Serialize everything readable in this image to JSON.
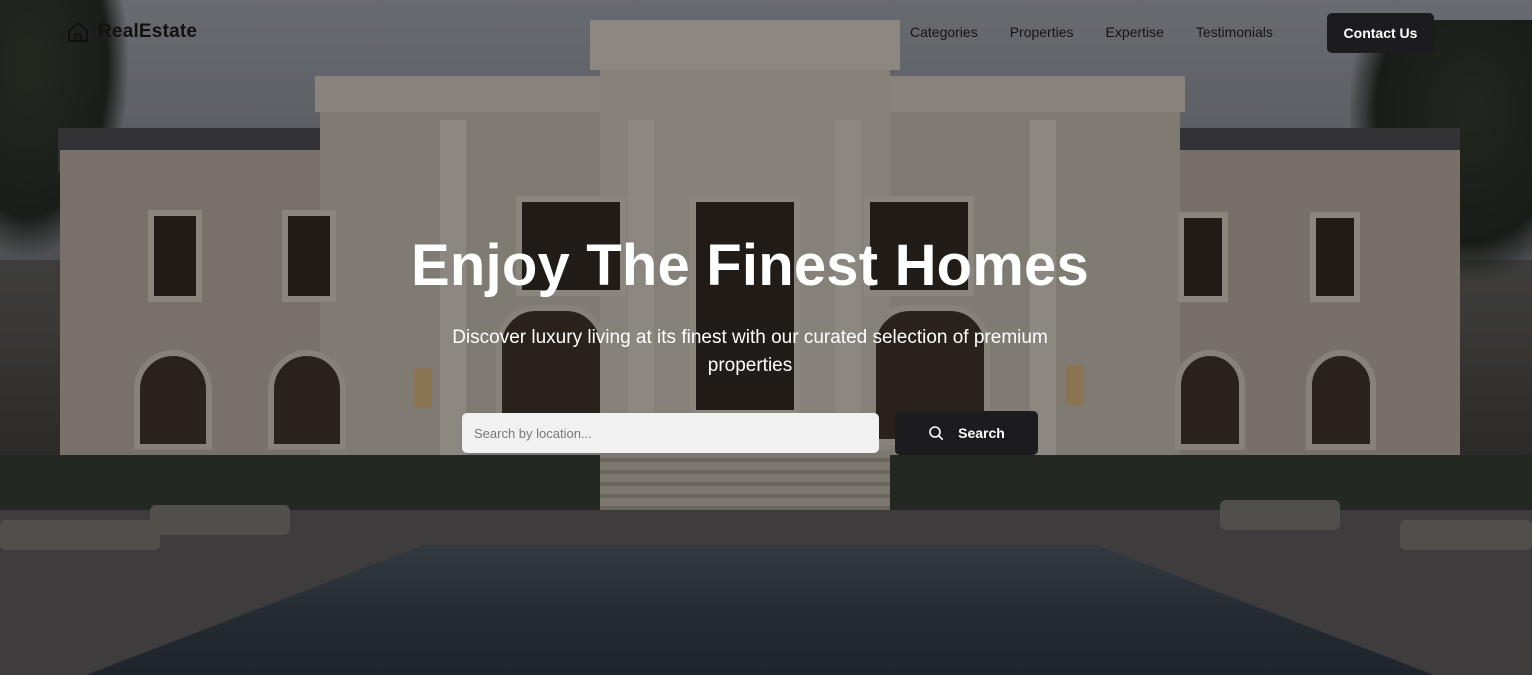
{
  "brand": {
    "name": "RealEstate",
    "icon": "home-icon"
  },
  "nav": {
    "links": [
      {
        "label": "Categories"
      },
      {
        "label": "Properties"
      },
      {
        "label": "Expertise"
      },
      {
        "label": "Testimonials"
      }
    ],
    "cta_label": "Contact Us"
  },
  "hero": {
    "title": "Enjoy The Finest Homes",
    "subtitle": "Discover luxury living at its finest with our curated selection of premium properties",
    "search": {
      "placeholder": "Search by location...",
      "value": "",
      "button_label": "Search",
      "button_icon": "search-icon"
    }
  },
  "colors": {
    "button_bg": "#1c1c1e",
    "button_text": "#ffffff",
    "nav_text": "#141414",
    "hero_text": "#ffffff"
  }
}
